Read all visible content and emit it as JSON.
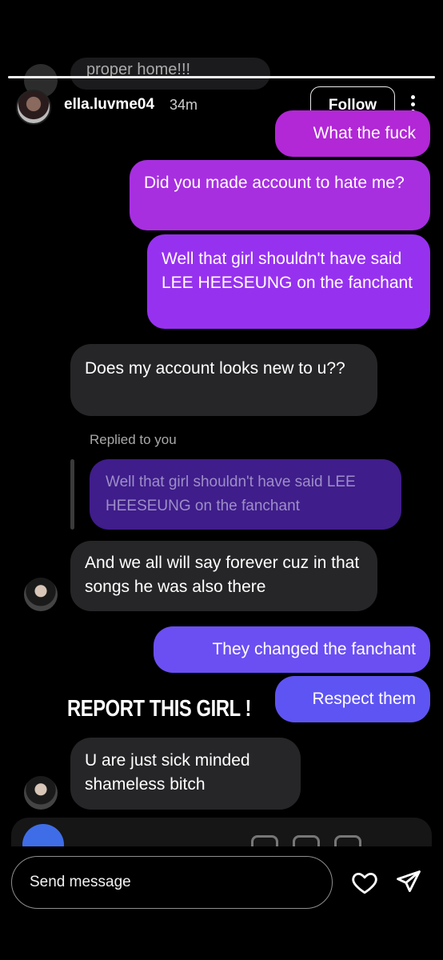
{
  "ghost": {
    "top_text": "proper home!!!"
  },
  "header": {
    "username": "ella.luvme04",
    "time": "34m",
    "follow_label": "Follow"
  },
  "messages": [
    {
      "direction": "sent",
      "text": "What the fuck"
    },
    {
      "direction": "sent",
      "text": "Did you made account to hate me?"
    },
    {
      "direction": "sent",
      "text": "Well that girl shouldn't have said LEE HEESEUNG on the fanchant"
    },
    {
      "direction": "received",
      "text": "Does my account looks new to u??"
    },
    {
      "direction": "received",
      "text": "And we all will say forever cuz in that songs he was also there"
    },
    {
      "direction": "sent",
      "text": "They changed the fanchant"
    },
    {
      "direction": "sent",
      "text": "Respect them"
    },
    {
      "direction": "received",
      "text": "U are just sick minded shameless bitch"
    }
  ],
  "reply": {
    "label": "Replied to you",
    "quoted": "Well that girl shouldn't have said LEE HEESEUNG on the fanchant"
  },
  "overlay_caption": "REPORT THIS GIRL !",
  "composer": {
    "placeholder": "Send message"
  },
  "icons": [
    "more-vertical-icon",
    "heart-icon",
    "send-icon"
  ],
  "colors": {
    "sent_purple": "#b227d6",
    "sent_violet": "#6b4ff2",
    "received_bg": "#262628",
    "background": "#000000"
  }
}
